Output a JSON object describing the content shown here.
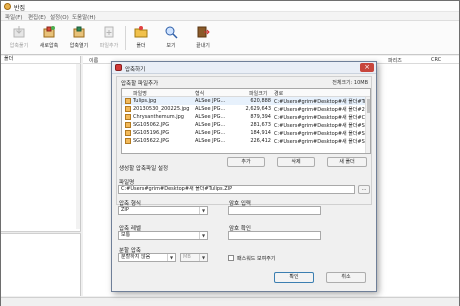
{
  "app": {
    "title": "반집",
    "menu": [
      "파일(F)",
      "편집(E)",
      "설정(O)",
      "도움말(H)"
    ],
    "toolbar": [
      {
        "label": "압축풀기",
        "icon": "extract-icon",
        "enabled": false
      },
      {
        "label": "새로압축",
        "icon": "new-archive-icon",
        "enabled": true
      },
      {
        "label": "압축열기",
        "icon": "open-archive-icon",
        "enabled": true
      },
      {
        "label": "파일추가",
        "icon": "add-file-icon",
        "enabled": false
      },
      {
        "label": "폴더",
        "icon": "folder-icon",
        "enabled": true
      },
      {
        "label": "보기",
        "icon": "view-icon",
        "enabled": true
      },
      {
        "label": "끝내기",
        "icon": "exit-icon",
        "enabled": true
      }
    ],
    "left_header": "폴더",
    "list_columns": [
      "이름",
      "파리즈",
      "CRC"
    ]
  },
  "dialog": {
    "title": "압축하기",
    "files_section_label": "압축할 파일추가",
    "total_size": "전체크기: 10MB",
    "file_columns": {
      "name": "파일명",
      "type": "형식",
      "size": "파일크기",
      "path": "경로"
    },
    "files": [
      {
        "name": "Tulips.jpg",
        "type": "ALSee JPG...",
        "size": "620,888",
        "path": "C:#Users#grim#Desktop#새 폴더#Tulips.jpg"
      },
      {
        "name": "20130530_200225.jpg",
        "type": "ALSee JPG...",
        "size": "2,629,643",
        "path": "C:#Users#grim#Desktop#새 폴더#2013..."
      },
      {
        "name": "Chrysanthemum.jpg",
        "type": "ALSee JPG...",
        "size": "879,394",
        "path": "C:#Users#grim#Desktop#새 폴더#Chrys..."
      },
      {
        "name": "SG105062.JPG",
        "type": "ALSee JPG...",
        "size": "281,673",
        "path": "C:#Users#grim#Desktop#새 폴더#SG10..."
      },
      {
        "name": "SG105196.JPG",
        "type": "ALSee JPG...",
        "size": "184,914",
        "path": "C:#Users#grim#Desktop#새 폴더#SG10..."
      },
      {
        "name": "SG105622.JPG",
        "type": "ALSee JPG...",
        "size": "226,412",
        "path": "C:#Users#grim#Desktop#새 폴더#SG10..."
      }
    ],
    "buttons": {
      "add": "추가",
      "delete": "삭제",
      "new_folder": "새 폴더",
      "ok": "확인",
      "cancel": "취소"
    },
    "settings_label": "생성할 압축파일 설정",
    "filename_label": "파일명",
    "filename_value": "C:#Users#grim#Desktop#새 폴더#Tulips.ZIP",
    "browse_label": "...",
    "format_label": "압축 형식",
    "format_value": "ZIP",
    "level_label": "압축 레벨",
    "level_value": "보통",
    "split_label": "분할 압축",
    "split_value": "분할하지 않음",
    "split_unit": "MB",
    "password_label": "암호 입력",
    "password_confirm_label": "암호 확인",
    "show_password_label": "패스워드 보여주기",
    "show_password_checked": false
  }
}
